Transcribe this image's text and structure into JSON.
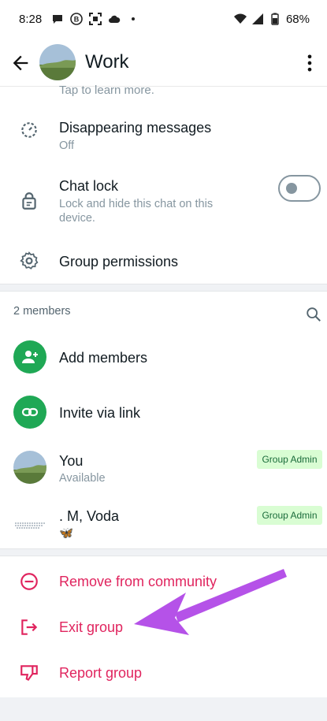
{
  "status_bar": {
    "time": "8:28",
    "battery": "68%",
    "icons": [
      "chat-bubble-icon",
      "b-circle-icon",
      "scan-icon",
      "cloud-icon",
      "dot-icon",
      "wifi-icon",
      "signal-icon",
      "battery-icon"
    ]
  },
  "header": {
    "title": "Work",
    "back_icon": "arrow-left-icon",
    "more_icon": "more-vert-icon"
  },
  "partial_text": "Tap to learn more.",
  "settings": {
    "disappearing": {
      "title": "Disappearing messages",
      "value": "Off"
    },
    "chat_lock": {
      "title": "Chat lock",
      "subtitle": "Lock and hide this chat on this device.",
      "enabled": false
    },
    "permissions": {
      "title": "Group permissions"
    }
  },
  "members": {
    "count_label": "2 members",
    "add_label": "Add members",
    "invite_label": "Invite via link",
    "list": [
      {
        "name": "You",
        "status": "Available",
        "badge": "Group Admin"
      },
      {
        "name": ". M, Voda",
        "status": "🦋",
        "badge": "Group Admin"
      }
    ]
  },
  "actions": {
    "remove": "Remove from community",
    "exit": "Exit group",
    "report": "Report group"
  },
  "colors": {
    "accent_green": "#1fa855",
    "danger": "#e0245e",
    "badge_bg": "#d9fdd3",
    "annotation_arrow": "#b552e8"
  }
}
